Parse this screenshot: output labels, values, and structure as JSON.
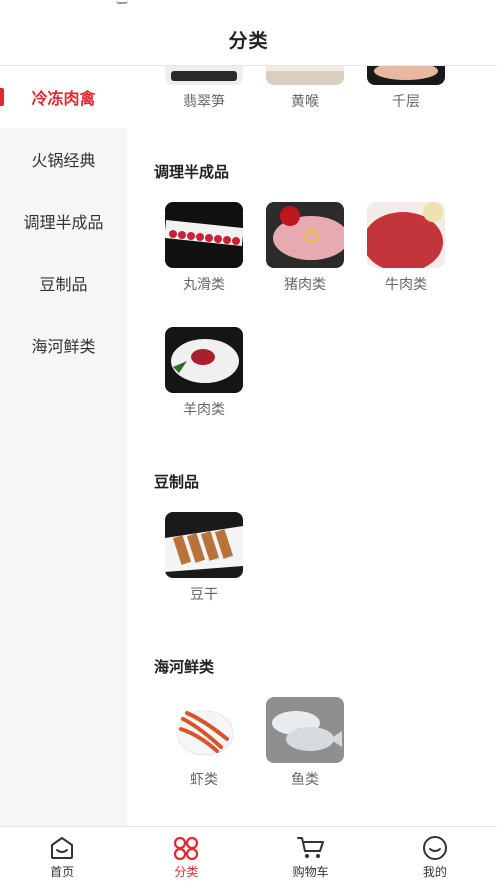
{
  "header": {
    "title": "分类"
  },
  "sidebar": {
    "items": [
      {
        "label": "冷冻肉禽"
      },
      {
        "label": "火锅经典"
      },
      {
        "label": "调理半成品"
      },
      {
        "label": "豆制品"
      },
      {
        "label": "海河鲜类"
      }
    ]
  },
  "content": {
    "top_partial_items": [
      "翡翠笋",
      "黄喉",
      "千层"
    ],
    "sections": [
      {
        "title": "调理半成品",
        "items": [
          "丸滑类",
          "猪肉类",
          "牛肉类",
          "羊肉类"
        ]
      },
      {
        "title": "豆制品",
        "items": [
          "豆干"
        ]
      },
      {
        "title": "海河鲜类",
        "items": [
          "虾类",
          "鱼类"
        ]
      }
    ]
  },
  "tabbar": {
    "tabs": [
      {
        "label": "首页",
        "icon": "home-icon"
      },
      {
        "label": "分类",
        "icon": "category-icon"
      },
      {
        "label": "购物车",
        "icon": "cart-icon"
      },
      {
        "label": "我的",
        "icon": "profile-icon"
      }
    ]
  },
  "colors": {
    "accent": "#e0282e",
    "sidebar_bg": "#f6f6f6"
  }
}
